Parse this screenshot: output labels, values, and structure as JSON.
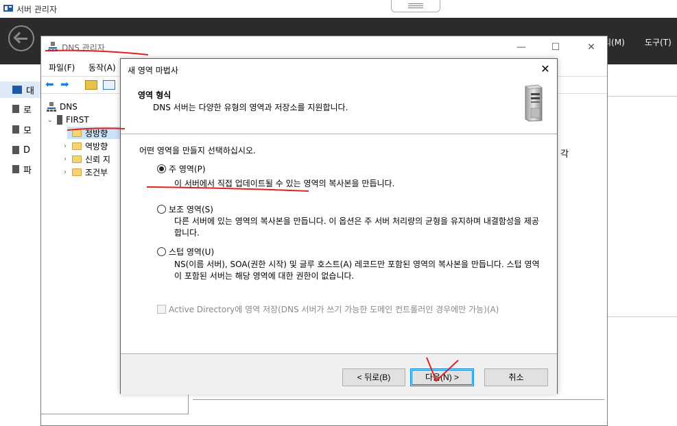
{
  "server_manager": {
    "title": "서버 관리자",
    "menu": {
      "manage": "리(M)",
      "tools": "도구(T)"
    },
    "nav": [
      {
        "label": "대",
        "active": true
      },
      {
        "label": "로"
      },
      {
        "label": "모"
      },
      {
        "label": "D"
      },
      {
        "label": "파"
      }
    ],
    "right_text": "각"
  },
  "dns_manager": {
    "title": "DNS 관리자",
    "menu": {
      "file": "파일(F)",
      "action": "동작(A)"
    },
    "tree": {
      "root": "DNS",
      "server": "FIRST",
      "items": [
        "정방향",
        "역방향",
        "신뢰 지",
        "조건부"
      ]
    }
  },
  "wizard": {
    "title": "새 영역 마법사",
    "heading": "영역 형식",
    "subheading": "DNS 서버는 다양한 유형의 영역과 저장소를 지원합니다.",
    "prompt": "어떤 영역을 만들지 선택하십시오.",
    "options": [
      {
        "label": "주 영역(P)",
        "checked": true,
        "desc": "이 서버에서 직접 업데이트될 수 있는 영역의 복사본을 만듭니다."
      },
      {
        "label": "보조 영역(S)",
        "checked": false,
        "desc": "다른 서버에 있는 영역의 복사본을 만듭니다. 이 옵션은 주 서버 처리량의 균형을 유지하며 내결함성을 제공합니다."
      },
      {
        "label": "스텁 영역(U)",
        "checked": false,
        "desc": "NS(이름 서버), SOA(권한 시작) 및 글루 호스트(A) 레코드만 포함된 영역의 복사본을 만듭니다. 스텁 영역이 포함된 서버는 해당 영역에 대한 권한이 없습니다."
      }
    ],
    "ad_checkbox": {
      "label": "Active Directory에 영역 저장(DNS 서버가 쓰기 가능한 도메인 컨트롤러인 경우에만 가능)(A)",
      "checked": false,
      "enabled": false
    },
    "buttons": {
      "back": "< 뒤로(B)",
      "next": "다음(N) >",
      "cancel": "취소"
    }
  },
  "colors": {
    "header_bg": "#2b2b2b",
    "annotation": "#e0201c",
    "focus": "#0078d7"
  }
}
